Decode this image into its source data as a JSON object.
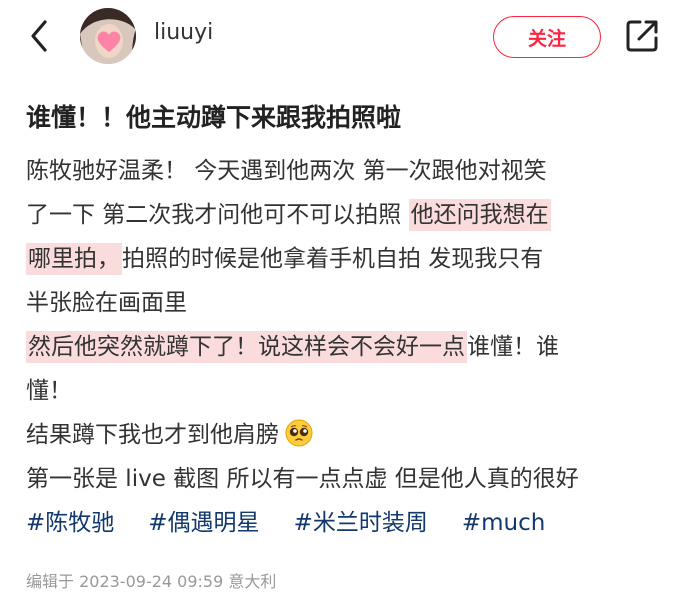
{
  "header": {
    "username": "liuuyi",
    "follow_label": "关注",
    "icons": {
      "back": "back-arrow-icon",
      "share": "share-icon"
    },
    "accent_color": "#ff2442"
  },
  "post": {
    "title": "谁懂！！他主动蹲下来跟我拍照啦",
    "lines": [
      {
        "segments": [
          {
            "text": "陈牧驰好温柔！ 今天遇到他两次 第一次跟他对视笑",
            "highlight": false
          }
        ]
      },
      {
        "segments": [
          {
            "text": "了一下 第二次我才问他可不可以拍照 ",
            "highlight": false
          },
          {
            "text": "他还问我想在",
            "highlight": true
          }
        ]
      },
      {
        "segments": [
          {
            "text": "哪里拍，",
            "highlight": true
          },
          {
            "text": "拍照的时候是他拿着手机自拍 发现我只有",
            "highlight": false
          }
        ]
      },
      {
        "segments": [
          {
            "text": "半张脸在画面里",
            "highlight": false
          }
        ]
      },
      {
        "segments": [
          {
            "text": "然后他突然就蹲下了！说这样会不会好一点",
            "highlight": true
          },
          {
            "text": "谁懂！谁",
            "highlight": false
          }
        ]
      },
      {
        "segments": [
          {
            "text": "懂！",
            "highlight": false
          }
        ]
      },
      {
        "segments": [
          {
            "text": "结果蹲下我也才到他肩膀",
            "highlight": false
          }
        ],
        "emoji": "pleading-face-emoji"
      },
      {
        "segments": [
          {
            "text": "第一张是 live 截图 所以有一点点虚 但是他人真的很好",
            "highlight": false
          }
        ]
      }
    ],
    "tags": [
      "#陈牧驰",
      "#偶遇明星",
      "#米兰时装周",
      "#much"
    ],
    "meta": "编辑于 2023-09-24 09:59 意大利",
    "highlight_color": "#fbdcdc",
    "tag_color": "#13386c"
  }
}
